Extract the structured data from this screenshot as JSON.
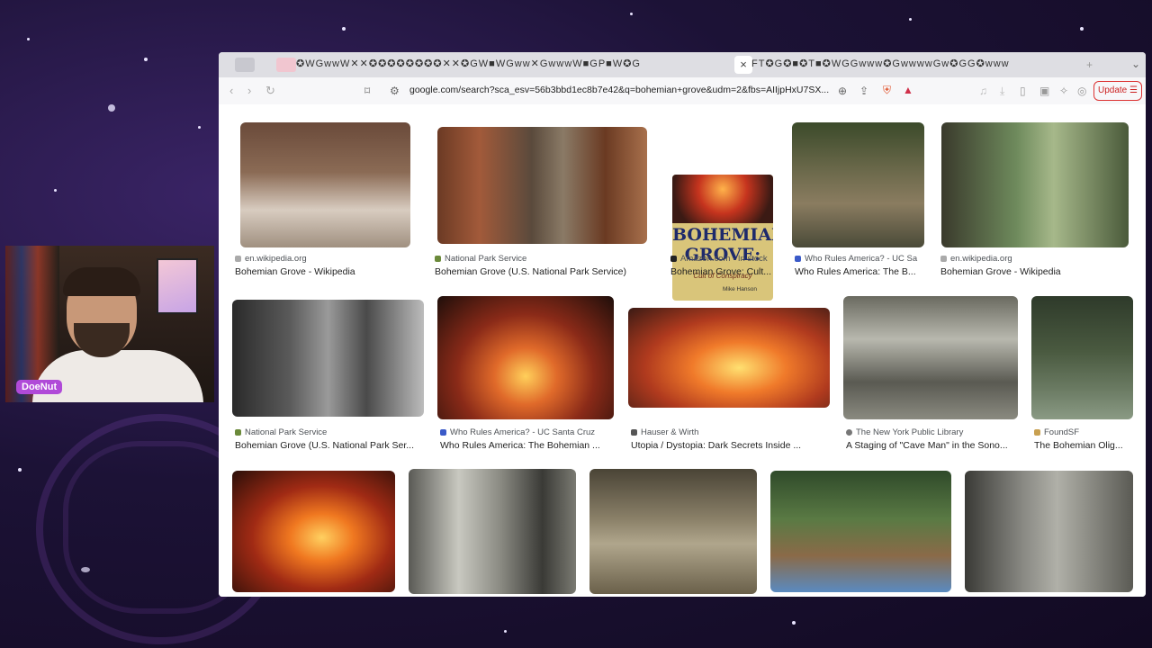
{
  "browser": {
    "tab_strip": "✪WGwwW✕✕✪✪✪✪✪✪✪✪✕✕✪GW■WGww✕GwwwW■GP■W✪G",
    "tab_strip_right": "FT✪G✪■✪T■✪WGGwww✪GwwwwGw✪GG✪www",
    "active_tab_close": "×",
    "url": "google.com/search?sca_esv=56b3bbd1ec8b7e42&q=bohemian+grove&udm=2&fbs=AIIjpHxU7SX...",
    "update_label": "Update"
  },
  "webcam": {
    "name": "DoeNut"
  },
  "results": [
    {
      "source": "en.wikipedia.org",
      "title": "Bohemian Grove - Wikipedia"
    },
    {
      "source": "National Park Service",
      "title": "Bohemian Grove (U.S. National Park Service)"
    },
    {
      "source": "Amazon.com · In stock",
      "title": "Bohemian Grove: Cult..."
    },
    {
      "source": "Who Rules America? - UC Sa",
      "title": "Who Rules America: The B..."
    },
    {
      "source": "en.wikipedia.org",
      "title": "Bohemian Grove - Wikipedia"
    },
    {
      "source": "National Park Service",
      "title": "Bohemian Grove (U.S. National Park Ser..."
    },
    {
      "source": "Who Rules America? - UC Santa Cruz",
      "title": "Who Rules America: The Bohemian ..."
    },
    {
      "source": "Hauser & Wirth",
      "title": "Utopia / Dystopia: Dark Secrets Inside ..."
    },
    {
      "source": "The New York Public Library",
      "title": "A Staging of \"Cave Man\" in the Sono..."
    },
    {
      "source": "FoundSF",
      "title": "The Bohemian Olig..."
    }
  ],
  "book": {
    "title1": "BOHEMIAN",
    "title2": "GROVE:",
    "subtitle": "Cult of Conspiracy",
    "author": "Mike Hanson"
  }
}
